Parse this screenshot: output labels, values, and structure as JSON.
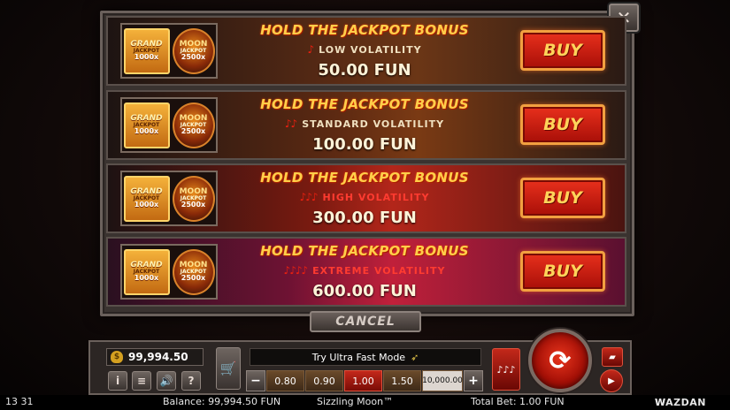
{
  "close_symbol": "✕",
  "offers": [
    {
      "title": "HOLD THE JACKPOT BONUS",
      "peppers": "♪",
      "volatility": "LOW VOLATILITY",
      "price": "50.00 FUN",
      "buy_label": "BUY",
      "thumb": {
        "grand": "GRAND",
        "grand_sub": "JACKPOT",
        "grand_mult": "1000x",
        "moon": "MOON",
        "moon_sub": "JACKPOT",
        "moon_mult": "2500x"
      }
    },
    {
      "title": "HOLD THE JACKPOT BONUS",
      "peppers": "♪♪",
      "volatility": "STANDARD VOLATILITY",
      "price": "100.00 FUN",
      "buy_label": "BUY",
      "thumb": {
        "grand": "GRAND",
        "grand_sub": "JACKPOT",
        "grand_mult": "1000x",
        "moon": "MOON",
        "moon_sub": "JACKPOT",
        "moon_mult": "2500x"
      }
    },
    {
      "title": "HOLD THE JACKPOT BONUS",
      "peppers": "♪♪♪",
      "volatility": "HIGH VOLATILITY",
      "price": "300.00 FUN",
      "buy_label": "BUY",
      "thumb": {
        "grand": "GRAND",
        "grand_sub": "JACKPOT",
        "grand_mult": "1000x",
        "moon": "MOON",
        "moon_sub": "JACKPOT",
        "moon_mult": "2500x"
      }
    },
    {
      "title": "HOLD THE JACKPOT BONUS",
      "peppers": "♪♪♪♪",
      "volatility": "EXTREME VOLATILITY",
      "price": "600.00 FUN",
      "buy_label": "BUY",
      "thumb": {
        "grand": "GRAND",
        "grand_sub": "JACKPOT",
        "grand_mult": "1000x",
        "moon": "MOON",
        "moon_sub": "JACKPOT",
        "moon_mult": "2500x"
      }
    }
  ],
  "cancel_label": "CANCEL",
  "controls": {
    "balance": "99,994.50",
    "info_icon": "i",
    "menu_icon": "≡",
    "sound_icon": "🔊",
    "help_icon": "?",
    "fast_mode_label": "Try Ultra Fast Mode",
    "minus": "−",
    "plus": "+",
    "bets": [
      "0.80",
      "0.90",
      "1.00",
      "1.50",
      "10,000.00"
    ],
    "selected_bet": "1.00",
    "volatility_glyph": "♪♪♪"
  },
  "status": {
    "time": "13 31",
    "balance": "Balance: 99,994.50 FUN",
    "game": "Sizzling Moon™",
    "total_bet": "Total Bet: 1.00 FUN",
    "brand": "WAZDAN"
  },
  "colors": {
    "buy_red": "#c3281a",
    "title_gold": "#ffcf4a",
    "panel_gray": "#3a3330"
  }
}
